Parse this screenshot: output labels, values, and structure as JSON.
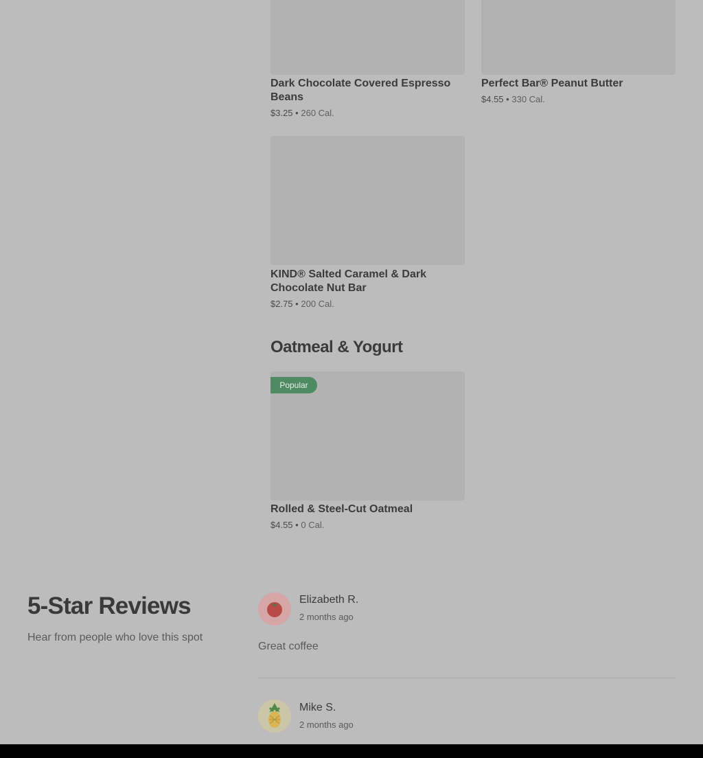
{
  "menu": {
    "items": [
      {
        "name": "Dark Chocolate Covered Espresso Beans",
        "price": "$3.25",
        "separator": "•",
        "calories": "260 Cal."
      },
      {
        "name": "Perfect Bar® Peanut Butter",
        "price": "$4.55",
        "separator": "•",
        "calories": "330 Cal."
      },
      {
        "name": "KIND® Salted Caramel & Dark Chocolate Nut Bar",
        "price": "$2.75",
        "separator": "•",
        "calories": "200 Cal."
      }
    ],
    "oatmeal_section": {
      "title": "Oatmeal & Yogurt",
      "items": [
        {
          "badge": "Popular",
          "name": "Rolled & Steel-Cut Oatmeal",
          "price": "$4.55",
          "separator": "•",
          "calories": "0 Cal."
        }
      ]
    }
  },
  "reviews": {
    "title": "5-Star Reviews",
    "subtitle": "Hear from people who love this spot",
    "entries": [
      {
        "name": "Elizabeth R.",
        "time": "2 months ago",
        "text": "Great coffee",
        "avatar_icon": "tomato-icon"
      },
      {
        "name": "Mike S.",
        "time": "2 months ago",
        "avatar_icon": "pineapple-icon"
      }
    ]
  },
  "colors": {
    "overlay_bg": "#bcbcbc",
    "image_placeholder": "#b2b2b2",
    "popular_badge": "#4e8a62"
  }
}
